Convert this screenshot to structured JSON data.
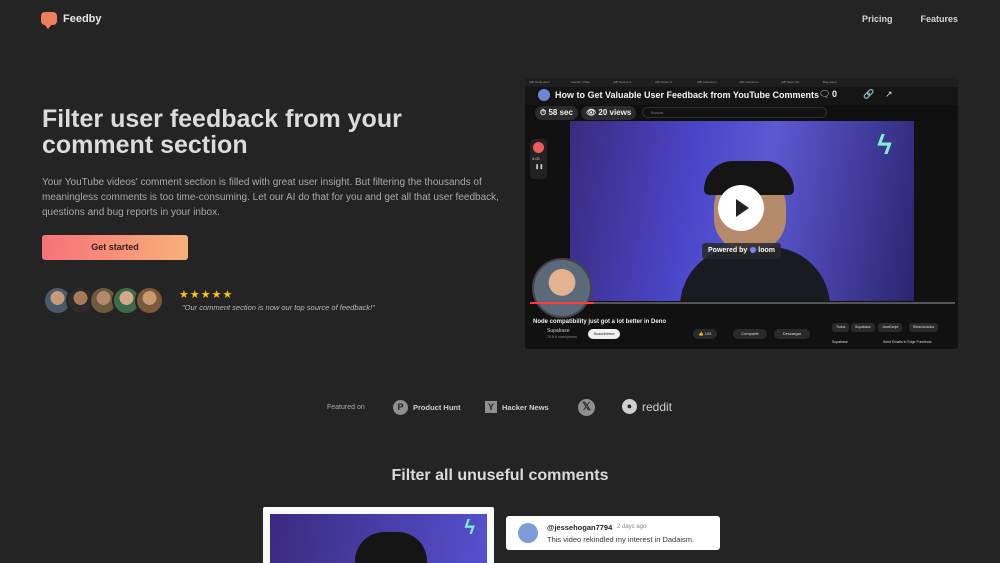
{
  "nav": {
    "brand": "Feedby",
    "links": [
      "Pricing",
      "Features"
    ]
  },
  "hero": {
    "title": "Filter user feedback from your comment section",
    "description": "Your YouTube videos' comment section is filled with great user insight. But filtering the thousands of meaningless comments is too time-consuming. Let our AI do that for you and get all that user feedback, questions and bug reports in your inbox.",
    "cta": "Get started",
    "rating": 5,
    "stars": "★★★★★",
    "quote": "\"Our comment section is now our top source of feedback!\""
  },
  "demo": {
    "tabs": [
      "(38) Node.js/en",
      "Feedby | Filter",
      "(28) Nest.js G",
      "(30) Notion 4",
      "(38) Instrumen",
      "(38) Instrumen",
      "(28) Meet Obi",
      "Bug panel"
    ],
    "video_title": "How to Get Valuable User Feedback from YouTube Comments",
    "comment_count": "0",
    "duration": "58 sec",
    "views": "20 views",
    "search_placeholder": "Buscar",
    "rec_time": "4:00",
    "powered_by": "Powered by",
    "powered_brand": "loom",
    "yt_video_title": "Node compatibility just got a lot better in Deno",
    "channel": "Supabase",
    "subscribers": "76.8 K suscriptores",
    "subscribe": "Suscribirme",
    "likes": "133",
    "share": "Compartir",
    "download": "Descargar",
    "chips": [
      "Todos",
      "Supabase",
      "JavaScript",
      "Relacionados"
    ],
    "related_title": "Send Emails in Edge Functions",
    "related_meta": "Supabase"
  },
  "featured": {
    "label": "Featured on",
    "items": [
      "Product Hunt",
      "Hacker News",
      "reddit"
    ]
  },
  "section": {
    "title": "Filter all unuseful comments"
  },
  "comment": {
    "user": "@jessehogan7794",
    "time": "2 days ago",
    "text": "This video rekindled my interest in Dadaism."
  },
  "colors": {
    "background": "#242424",
    "cta_gradient_start": "#f7717a",
    "cta_gradient_end": "#f7b07a",
    "star": "#f5c518",
    "accent_mint": "#7ef0d0"
  }
}
